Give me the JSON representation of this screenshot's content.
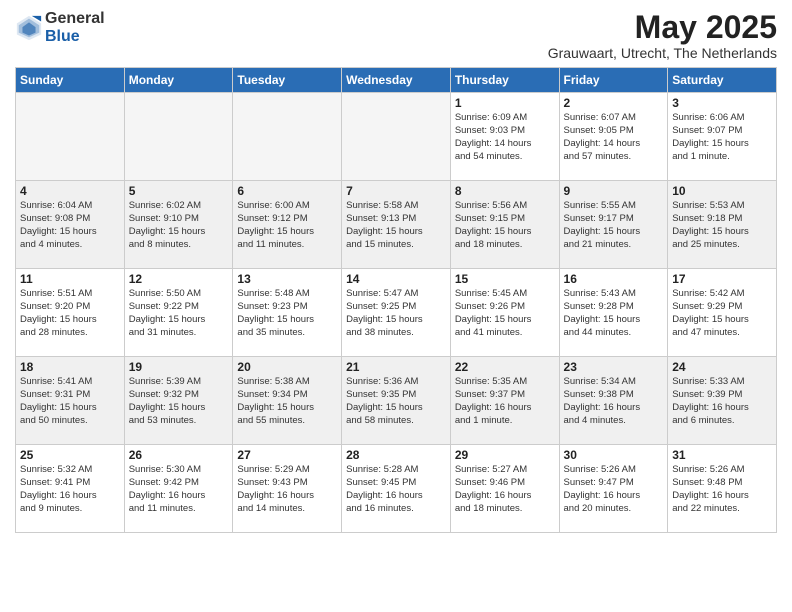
{
  "logo": {
    "general": "General",
    "blue": "Blue"
  },
  "title": {
    "month_year": "May 2025",
    "location": "Grauwaart, Utrecht, The Netherlands"
  },
  "days_of_week": [
    "Sunday",
    "Monday",
    "Tuesday",
    "Wednesday",
    "Thursday",
    "Friday",
    "Saturday"
  ],
  "weeks": [
    {
      "row_shade": false,
      "days": [
        {
          "num": "",
          "info": "",
          "empty": true
        },
        {
          "num": "",
          "info": "",
          "empty": true
        },
        {
          "num": "",
          "info": "",
          "empty": true
        },
        {
          "num": "",
          "info": "",
          "empty": true
        },
        {
          "num": "1",
          "info": "Sunrise: 6:09 AM\nSunset: 9:03 PM\nDaylight: 14 hours\nand 54 minutes.",
          "empty": false
        },
        {
          "num": "2",
          "info": "Sunrise: 6:07 AM\nSunset: 9:05 PM\nDaylight: 14 hours\nand 57 minutes.",
          "empty": false
        },
        {
          "num": "3",
          "info": "Sunrise: 6:06 AM\nSunset: 9:07 PM\nDaylight: 15 hours\nand 1 minute.",
          "empty": false
        }
      ]
    },
    {
      "row_shade": true,
      "days": [
        {
          "num": "4",
          "info": "Sunrise: 6:04 AM\nSunset: 9:08 PM\nDaylight: 15 hours\nand 4 minutes.",
          "empty": false
        },
        {
          "num": "5",
          "info": "Sunrise: 6:02 AM\nSunset: 9:10 PM\nDaylight: 15 hours\nand 8 minutes.",
          "empty": false
        },
        {
          "num": "6",
          "info": "Sunrise: 6:00 AM\nSunset: 9:12 PM\nDaylight: 15 hours\nand 11 minutes.",
          "empty": false
        },
        {
          "num": "7",
          "info": "Sunrise: 5:58 AM\nSunset: 9:13 PM\nDaylight: 15 hours\nand 15 minutes.",
          "empty": false
        },
        {
          "num": "8",
          "info": "Sunrise: 5:56 AM\nSunset: 9:15 PM\nDaylight: 15 hours\nand 18 minutes.",
          "empty": false
        },
        {
          "num": "9",
          "info": "Sunrise: 5:55 AM\nSunset: 9:17 PM\nDaylight: 15 hours\nand 21 minutes.",
          "empty": false
        },
        {
          "num": "10",
          "info": "Sunrise: 5:53 AM\nSunset: 9:18 PM\nDaylight: 15 hours\nand 25 minutes.",
          "empty": false
        }
      ]
    },
    {
      "row_shade": false,
      "days": [
        {
          "num": "11",
          "info": "Sunrise: 5:51 AM\nSunset: 9:20 PM\nDaylight: 15 hours\nand 28 minutes.",
          "empty": false
        },
        {
          "num": "12",
          "info": "Sunrise: 5:50 AM\nSunset: 9:22 PM\nDaylight: 15 hours\nand 31 minutes.",
          "empty": false
        },
        {
          "num": "13",
          "info": "Sunrise: 5:48 AM\nSunset: 9:23 PM\nDaylight: 15 hours\nand 35 minutes.",
          "empty": false
        },
        {
          "num": "14",
          "info": "Sunrise: 5:47 AM\nSunset: 9:25 PM\nDaylight: 15 hours\nand 38 minutes.",
          "empty": false
        },
        {
          "num": "15",
          "info": "Sunrise: 5:45 AM\nSunset: 9:26 PM\nDaylight: 15 hours\nand 41 minutes.",
          "empty": false
        },
        {
          "num": "16",
          "info": "Sunrise: 5:43 AM\nSunset: 9:28 PM\nDaylight: 15 hours\nand 44 minutes.",
          "empty": false
        },
        {
          "num": "17",
          "info": "Sunrise: 5:42 AM\nSunset: 9:29 PM\nDaylight: 15 hours\nand 47 minutes.",
          "empty": false
        }
      ]
    },
    {
      "row_shade": true,
      "days": [
        {
          "num": "18",
          "info": "Sunrise: 5:41 AM\nSunset: 9:31 PM\nDaylight: 15 hours\nand 50 minutes.",
          "empty": false
        },
        {
          "num": "19",
          "info": "Sunrise: 5:39 AM\nSunset: 9:32 PM\nDaylight: 15 hours\nand 53 minutes.",
          "empty": false
        },
        {
          "num": "20",
          "info": "Sunrise: 5:38 AM\nSunset: 9:34 PM\nDaylight: 15 hours\nand 55 minutes.",
          "empty": false
        },
        {
          "num": "21",
          "info": "Sunrise: 5:36 AM\nSunset: 9:35 PM\nDaylight: 15 hours\nand 58 minutes.",
          "empty": false
        },
        {
          "num": "22",
          "info": "Sunrise: 5:35 AM\nSunset: 9:37 PM\nDaylight: 16 hours\nand 1 minute.",
          "empty": false
        },
        {
          "num": "23",
          "info": "Sunrise: 5:34 AM\nSunset: 9:38 PM\nDaylight: 16 hours\nand 4 minutes.",
          "empty": false
        },
        {
          "num": "24",
          "info": "Sunrise: 5:33 AM\nSunset: 9:39 PM\nDaylight: 16 hours\nand 6 minutes.",
          "empty": false
        }
      ]
    },
    {
      "row_shade": false,
      "days": [
        {
          "num": "25",
          "info": "Sunrise: 5:32 AM\nSunset: 9:41 PM\nDaylight: 16 hours\nand 9 minutes.",
          "empty": false
        },
        {
          "num": "26",
          "info": "Sunrise: 5:30 AM\nSunset: 9:42 PM\nDaylight: 16 hours\nand 11 minutes.",
          "empty": false
        },
        {
          "num": "27",
          "info": "Sunrise: 5:29 AM\nSunset: 9:43 PM\nDaylight: 16 hours\nand 14 minutes.",
          "empty": false
        },
        {
          "num": "28",
          "info": "Sunrise: 5:28 AM\nSunset: 9:45 PM\nDaylight: 16 hours\nand 16 minutes.",
          "empty": false
        },
        {
          "num": "29",
          "info": "Sunrise: 5:27 AM\nSunset: 9:46 PM\nDaylight: 16 hours\nand 18 minutes.",
          "empty": false
        },
        {
          "num": "30",
          "info": "Sunrise: 5:26 AM\nSunset: 9:47 PM\nDaylight: 16 hours\nand 20 minutes.",
          "empty": false
        },
        {
          "num": "31",
          "info": "Sunrise: 5:26 AM\nSunset: 9:48 PM\nDaylight: 16 hours\nand 22 minutes.",
          "empty": false
        }
      ]
    }
  ]
}
